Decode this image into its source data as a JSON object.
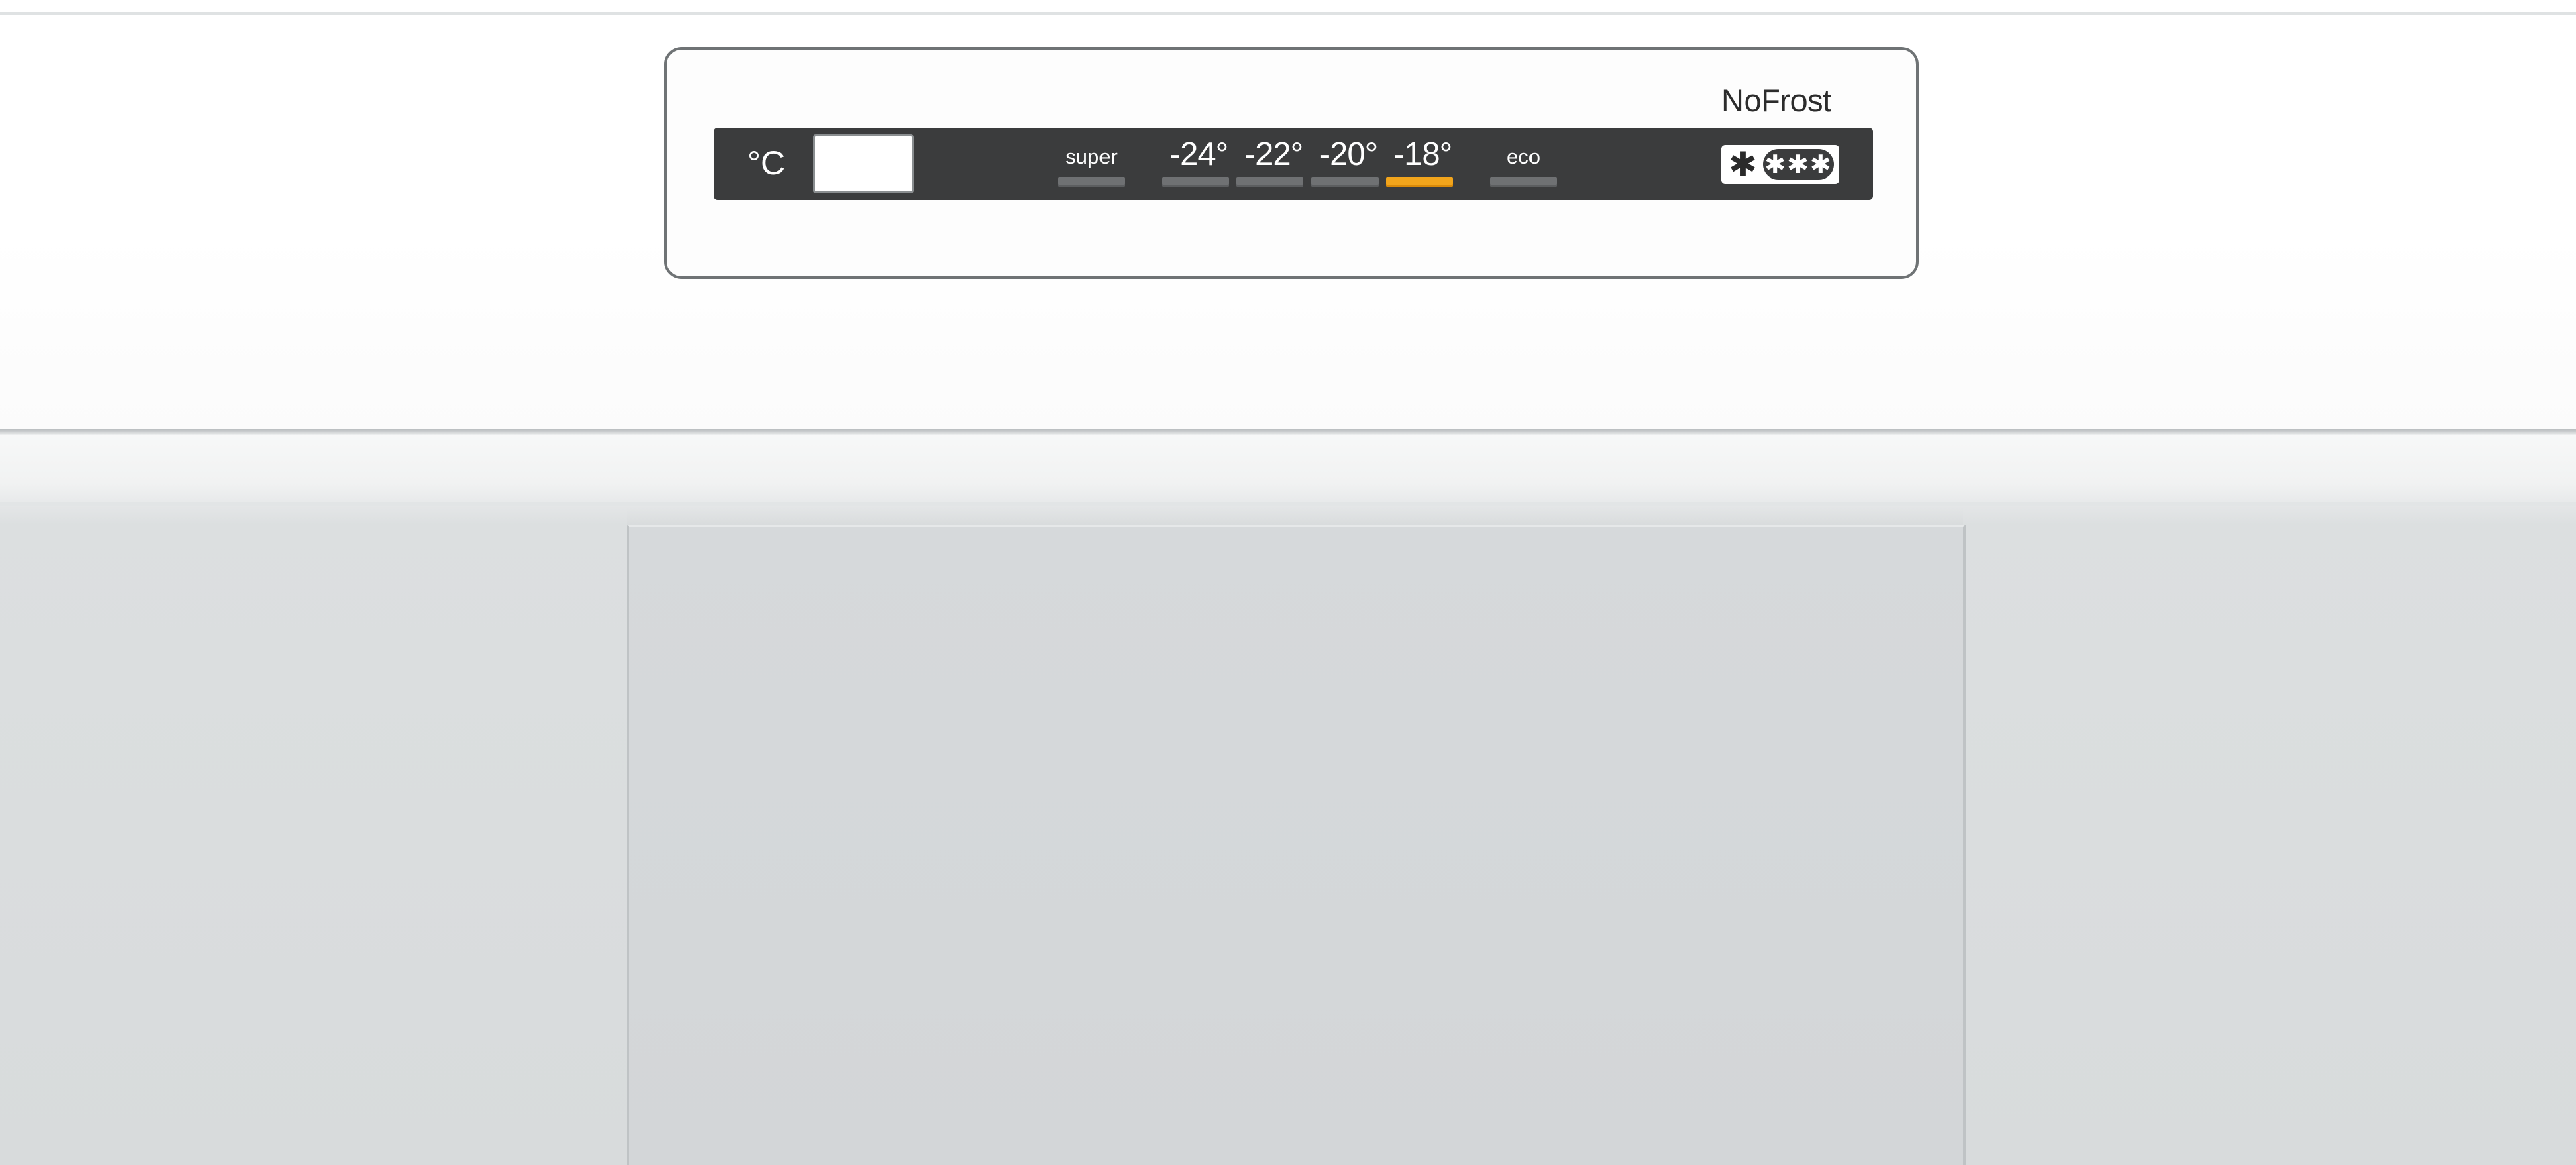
{
  "control_panel": {
    "brand_label": "NoFrost",
    "unit_label": "°C",
    "modes": [
      {
        "label": "super",
        "active": false
      },
      {
        "label": "-24°",
        "active": false
      },
      {
        "label": "-22°",
        "active": false
      },
      {
        "label": "-20°",
        "active": false
      },
      {
        "label": "-18°",
        "active": true
      },
      {
        "label": "eco",
        "active": false
      }
    ],
    "freezer_rating": {
      "single_star": "✱",
      "star_group": "✱✱✱"
    }
  },
  "colors": {
    "display_background": "#3b3c3d",
    "indicator_active": "#f2a51c",
    "indicator_inactive": "#6f7173",
    "door": "#ffffff",
    "drawer": "#d6d9db"
  }
}
